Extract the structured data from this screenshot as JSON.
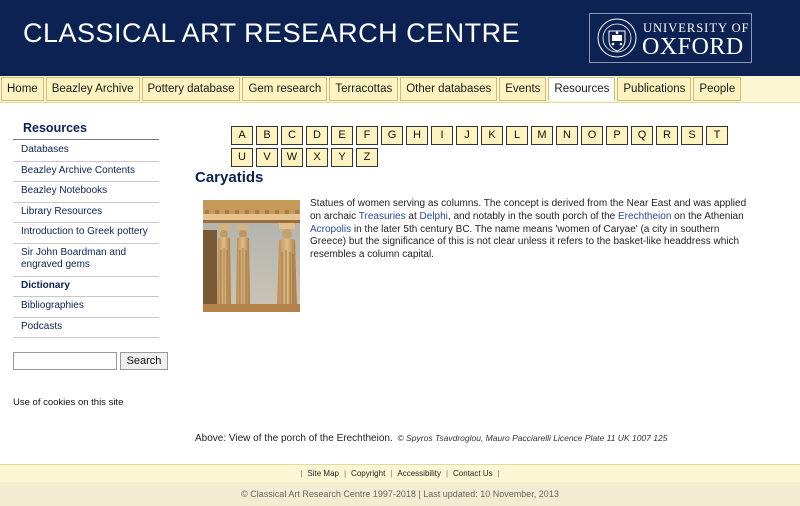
{
  "header": {
    "site_title": "CLASSICAL ART RESEARCH CENTRE",
    "university_small": "UNIVERSITY OF",
    "university_big": "OXFORD"
  },
  "topnav": [
    "Home",
    "Beazley Archive",
    "Pottery database",
    "Gem research",
    "Terracottas",
    "Other databases",
    "Events",
    "Resources",
    "Publications",
    "People"
  ],
  "topnav_active": "Resources",
  "sidebar": {
    "title": "Resources",
    "items": [
      "Databases",
      "Beazley Archive Contents",
      "Beazley Notebooks",
      "Library Resources",
      "Introduction to Greek pottery",
      "Sir John Boardman and engraved gems",
      "Dictionary",
      "Bibliographies",
      "Podcasts"
    ],
    "active_item": "Dictionary",
    "search_value": "",
    "search_button": "Search",
    "cookies_link": "Use of cookies on this site"
  },
  "alphabet": [
    "A",
    "B",
    "C",
    "D",
    "E",
    "F",
    "G",
    "H",
    "I",
    "J",
    "K",
    "L",
    "M",
    "N",
    "O",
    "P",
    "Q",
    "R",
    "S",
    "T",
    "U",
    "V",
    "W",
    "X",
    "Y",
    "Z"
  ],
  "entry": {
    "title": "Caryatids",
    "text_1": "Statues of women serving as columns. The concept is derived from the Near East and was applied on archaic ",
    "link_1": "Treasuries",
    "text_2": " at ",
    "link_2": "Delphi",
    "text_3": ", and notably in the south porch of the ",
    "link_3": "Erechtheion",
    "text_4": " on the Athenian ",
    "link_4": "Acropolis",
    "text_5": " in the later 5th century BC. The name means 'women of Caryae' (a city in southern Greece) but the significance of this is not clear unless it refers to the basket-like headdress which resembles a column capital.",
    "caption": "Above: View of the porch of the Erechtheion.",
    "credit": "© Spyros Tsavdroglou, Mauro Pacciarelli Licence Plate 11 UK 1007 125"
  },
  "footer": {
    "links": [
      "Site Map",
      "Copyright",
      "Accessibility",
      "Contact Us"
    ],
    "copyright": "© Classical Art Research Centre 1997-2018 | Last updated: 10 November, 2013"
  },
  "colors": {
    "header_bg": "#0c2253",
    "nav_bg": "#fdf3c0",
    "link": "#2a4aa0"
  }
}
